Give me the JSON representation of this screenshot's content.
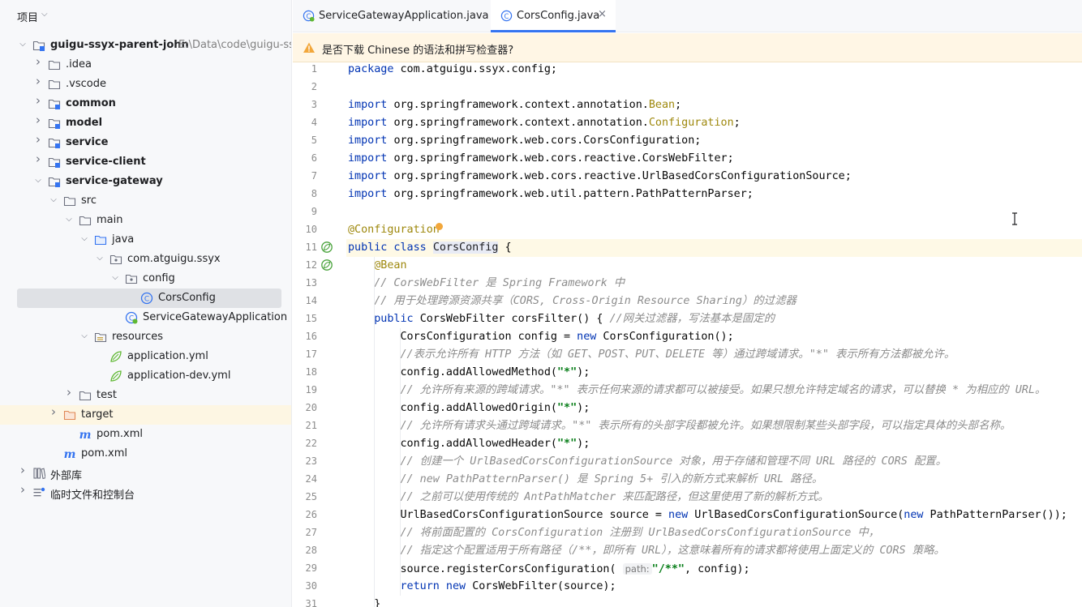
{
  "sidebar": {
    "title": "项目",
    "tree": [
      {
        "label": "guigu-ssyx-parent-john",
        "path": "E:\\Data\\code\\guigu-ssyx-",
        "level": 0,
        "icon": "module-folder-icon",
        "chevron": "open",
        "bold": true
      },
      {
        "label": ".idea",
        "level": 1,
        "icon": "folder-icon",
        "chevron": "closed"
      },
      {
        "label": ".vscode",
        "level": 1,
        "icon": "folder-icon",
        "chevron": "closed"
      },
      {
        "label": "common",
        "level": 1,
        "icon": "module-folder-icon",
        "chevron": "closed",
        "bold": true
      },
      {
        "label": "model",
        "level": 1,
        "icon": "module-folder-icon",
        "chevron": "closed",
        "bold": true
      },
      {
        "label": "service",
        "level": 1,
        "icon": "module-folder-icon",
        "chevron": "closed",
        "bold": true
      },
      {
        "label": "service-client",
        "level": 1,
        "icon": "module-folder-icon",
        "chevron": "closed",
        "bold": true
      },
      {
        "label": "service-gateway",
        "level": 1,
        "icon": "module-folder-icon",
        "chevron": "open",
        "bold": true
      },
      {
        "label": "src",
        "level": 2,
        "icon": "folder-icon",
        "chevron": "open"
      },
      {
        "label": "main",
        "level": 3,
        "icon": "folder-icon",
        "chevron": "open"
      },
      {
        "label": "java",
        "level": 4,
        "icon": "source-folder-icon",
        "chevron": "open"
      },
      {
        "label": "com.atguigu.ssyx",
        "level": 5,
        "icon": "package-icon",
        "chevron": "open"
      },
      {
        "label": "config",
        "level": 6,
        "icon": "package-icon",
        "chevron": "open"
      },
      {
        "label": "CorsConfig",
        "level": 7,
        "icon": "class-icon",
        "selected": true
      },
      {
        "label": "ServiceGatewayApplication",
        "level": 6,
        "icon": "spring-class-icon"
      },
      {
        "label": "resources",
        "level": 4,
        "icon": "resources-folder-icon",
        "chevron": "open"
      },
      {
        "label": "application.yml",
        "level": 5,
        "icon": "spring-yml-icon"
      },
      {
        "label": "application-dev.yml",
        "level": 5,
        "icon": "spring-yml-icon"
      },
      {
        "label": "test",
        "level": 3,
        "icon": "folder-icon",
        "chevron": "closed"
      },
      {
        "label": "target",
        "level": 2,
        "icon": "excluded-folder-icon",
        "chevron": "closed",
        "highlight": true
      },
      {
        "label": "pom.xml",
        "level": 3,
        "icon": "maven-icon"
      },
      {
        "label": "pom.xml",
        "level": 2,
        "icon": "maven-icon"
      },
      {
        "label": "外部库",
        "level": 0,
        "icon": "library-icon",
        "chevron": "closed"
      },
      {
        "label": "临时文件和控制台",
        "level": 0,
        "icon": "scratches-icon",
        "chevron": "closed"
      }
    ]
  },
  "tabs": [
    {
      "label": "ServiceGatewayApplication.java",
      "icon": "spring-class-icon",
      "active": false
    },
    {
      "label": "CorsConfig.java",
      "icon": "class-icon",
      "active": true,
      "close": "×"
    }
  ],
  "notice": {
    "text": "是否下载 Chinese 的语法和拼写检查器?",
    "icon": "warning-icon"
  },
  "colors": {
    "accent": "#3574f0",
    "keyword": "#0033b3",
    "annotation": "#9e880d",
    "comment": "#8c8c8c",
    "string": "#067d17"
  },
  "editor": {
    "lines": [
      {
        "n": "1",
        "tokens": [
          [
            "kw",
            "package "
          ],
          [
            "id",
            "com.atguigu.ssyx.config;"
          ]
        ]
      },
      {
        "n": "2",
        "tokens": []
      },
      {
        "n": "3",
        "tokens": [
          [
            "kw",
            "import "
          ],
          [
            "id",
            "org.springframework.context.annotation."
          ],
          [
            "ann",
            "Bean"
          ],
          [
            "id",
            ";"
          ]
        ]
      },
      {
        "n": "4",
        "tokens": [
          [
            "kw",
            "import "
          ],
          [
            "id",
            "org.springframework.context.annotation."
          ],
          [
            "ann",
            "Configuration"
          ],
          [
            "id",
            ";"
          ]
        ]
      },
      {
        "n": "5",
        "tokens": [
          [
            "kw",
            "import "
          ],
          [
            "id",
            "org.springframework.web.cors.CorsConfiguration;"
          ]
        ]
      },
      {
        "n": "6",
        "tokens": [
          [
            "kw",
            "import "
          ],
          [
            "id",
            "org.springframework.web.cors.reactive.CorsWebFilter;"
          ]
        ]
      },
      {
        "n": "7",
        "tokens": [
          [
            "kw",
            "import "
          ],
          [
            "id",
            "org.springframework.web.cors.reactive.UrlBasedCorsConfigurationSource;"
          ]
        ]
      },
      {
        "n": "8",
        "tokens": [
          [
            "kw",
            "import "
          ],
          [
            "id",
            "org.springframework.web.util.pattern.PathPatternParser;"
          ]
        ]
      },
      {
        "n": "9",
        "tokens": []
      },
      {
        "n": "10",
        "tokens": [
          [
            "ann",
            "@Configuration"
          ]
        ],
        "bulb": true
      },
      {
        "n": "11",
        "tokens": [
          [
            "kw",
            "public class "
          ],
          [
            "cc-hl",
            "CorsConfig"
          ],
          [
            "id",
            " {"
          ]
        ],
        "gutter_icon": "spring-bean-icon",
        "caret": true
      },
      {
        "n": "12",
        "tokens": [
          [
            "id",
            "    "
          ],
          [
            "ann",
            "@Bean"
          ]
        ],
        "gutter_icon": "spring-bean-icon"
      },
      {
        "n": "13",
        "tokens": [
          [
            "id",
            "    "
          ],
          [
            "cmt",
            "// CorsWebFilter 是 Spring Framework 中"
          ]
        ]
      },
      {
        "n": "14",
        "tokens": [
          [
            "id",
            "    "
          ],
          [
            "cmt",
            "// 用于处理跨源资源共享（CORS, Cross-Origin Resource Sharing）的过滤器"
          ]
        ]
      },
      {
        "n": "15",
        "tokens": [
          [
            "id",
            "    "
          ],
          [
            "kw",
            "public "
          ],
          [
            "id",
            "CorsWebFilter corsFilter() { "
          ],
          [
            "cmt",
            "//网关过滤器，写法基本是固定的"
          ]
        ]
      },
      {
        "n": "16",
        "tokens": [
          [
            "id",
            "        CorsConfiguration config = "
          ],
          [
            "kw",
            "new "
          ],
          [
            "id",
            "CorsConfiguration();"
          ]
        ]
      },
      {
        "n": "17",
        "tokens": [
          [
            "id",
            "        "
          ],
          [
            "cmt",
            "//表示允许所有 HTTP 方法（如 GET、POST、PUT、DELETE 等）通过跨域请求。\"*\" 表示所有方法都被允许。"
          ]
        ]
      },
      {
        "n": "18",
        "tokens": [
          [
            "id",
            "        config.addAllowedMethod("
          ],
          [
            "str",
            "\"*\""
          ],
          [
            "id",
            ");"
          ]
        ]
      },
      {
        "n": "19",
        "tokens": [
          [
            "id",
            "        "
          ],
          [
            "cmt",
            "// 允许所有来源的跨域请求。\"*\" 表示任何来源的请求都可以被接受。如果只想允许特定域名的请求，可以替换 * 为相应的 URL。"
          ]
        ]
      },
      {
        "n": "20",
        "tokens": [
          [
            "id",
            "        config.addAllowedOrigin("
          ],
          [
            "str",
            "\"*\""
          ],
          [
            "id",
            ");"
          ]
        ]
      },
      {
        "n": "21",
        "tokens": [
          [
            "id",
            "        "
          ],
          [
            "cmt",
            "// 允许所有请求头通过跨域请求。\"*\" 表示所有的头部字段都被允许。如果想限制某些头部字段，可以指定具体的头部名称。"
          ]
        ]
      },
      {
        "n": "22",
        "tokens": [
          [
            "id",
            "        config.addAllowedHeader("
          ],
          [
            "str",
            "\"*\""
          ],
          [
            "id",
            ");"
          ]
        ]
      },
      {
        "n": "23",
        "tokens": [
          [
            "id",
            "        "
          ],
          [
            "cmt",
            "// 创建一个 UrlBasedCorsConfigurationSource 对象，用于存储和管理不同 URL 路径的 CORS 配置。"
          ]
        ]
      },
      {
        "n": "24",
        "tokens": [
          [
            "id",
            "        "
          ],
          [
            "cmt",
            "// new PathPatternParser() 是 Spring 5+ 引入的新方式来解析 URL 路径。"
          ]
        ]
      },
      {
        "n": "25",
        "tokens": [
          [
            "id",
            "        "
          ],
          [
            "cmt",
            "// 之前可以使用传统的 AntPathMatcher 来匹配路径，但这里使用了新的解析方式。"
          ]
        ]
      },
      {
        "n": "26",
        "tokens": [
          [
            "id",
            "        UrlBasedCorsConfigurationSource source = "
          ],
          [
            "kw",
            "new "
          ],
          [
            "id",
            "UrlBasedCorsConfigurationSource("
          ],
          [
            "kw",
            "new "
          ],
          [
            "id",
            "PathPatternParser());"
          ]
        ]
      },
      {
        "n": "27",
        "tokens": [
          [
            "id",
            "        "
          ],
          [
            "cmt",
            "// 将前面配置的 CorsConfiguration 注册到 UrlBasedCorsConfigurationSource 中，"
          ]
        ]
      },
      {
        "n": "28",
        "tokens": [
          [
            "id",
            "        "
          ],
          [
            "cmt",
            "// 指定这个配置适用于所有路径（/**，即所有 URL），这意味着所有的请求都将使用上面定义的 CORS 策略。"
          ]
        ]
      },
      {
        "n": "29",
        "tokens": [
          [
            "id",
            "        source.registerCorsConfiguration( "
          ],
          [
            "hint",
            "path:"
          ],
          [
            "str",
            "\"/**\""
          ],
          [
            "id",
            ", config);"
          ]
        ]
      },
      {
        "n": "30",
        "tokens": [
          [
            "id",
            "        "
          ],
          [
            "kw",
            "return new "
          ],
          [
            "id",
            "CorsWebFilter(source);"
          ]
        ]
      },
      {
        "n": "31",
        "tokens": [
          [
            "id",
            "    }"
          ]
        ]
      }
    ]
  }
}
